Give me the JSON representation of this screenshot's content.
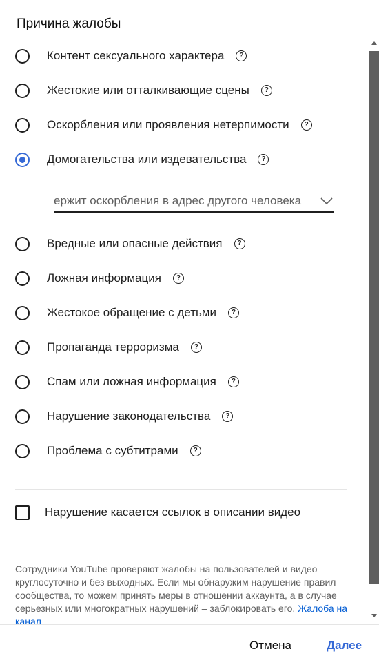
{
  "dialog": {
    "title": "Причина жалобы",
    "options": [
      {
        "label": "Контент сексуального характера",
        "checked": false
      },
      {
        "label": "Жестокие или отталкивающие сцены",
        "checked": false
      },
      {
        "label": "Оскорбления или проявления нетерпимости",
        "checked": false
      },
      {
        "label": "Домогательства или издевательства",
        "checked": true
      },
      {
        "label": "Вредные или опасные действия",
        "checked": false
      },
      {
        "label": "Ложная информация",
        "checked": false
      },
      {
        "label": "Жестокое обращение с детьми",
        "checked": false
      },
      {
        "label": "Пропаганда терроризма",
        "checked": false
      },
      {
        "label": "Спам или ложная информация",
        "checked": false
      },
      {
        "label": "Нарушение законодательства",
        "checked": false
      },
      {
        "label": "Проблема с субтитрами",
        "checked": false
      }
    ],
    "help_glyph": "?",
    "subreason_select": {
      "value": "ержит оскорбления в адрес другого человека"
    },
    "checkbox": {
      "label": "Нарушение касается ссылок в описании видео",
      "checked": false
    },
    "notice": {
      "text": "Сотрудники YouTube проверяют жалобы на пользователей и видео круглосуточно и без выходных. Если мы обнаружим нарушение правил сообщества, то можем принять меры в отношении аккаунта, а в случае серьезных или многократных нарушений – заблокировать его.",
      "link": "Жалоба на канал"
    },
    "footer": {
      "cancel_label": "Отмена",
      "next_label": "Далее"
    }
  },
  "colors": {
    "accent": "#3569d6",
    "link": "#065fd4",
    "secondary_text": "#606060"
  },
  "icons": {
    "help": "help-circle-icon",
    "dropdown": "chevron-down-icon",
    "scroll_up": "arrow-up-icon",
    "scroll_down": "arrow-down-icon"
  }
}
